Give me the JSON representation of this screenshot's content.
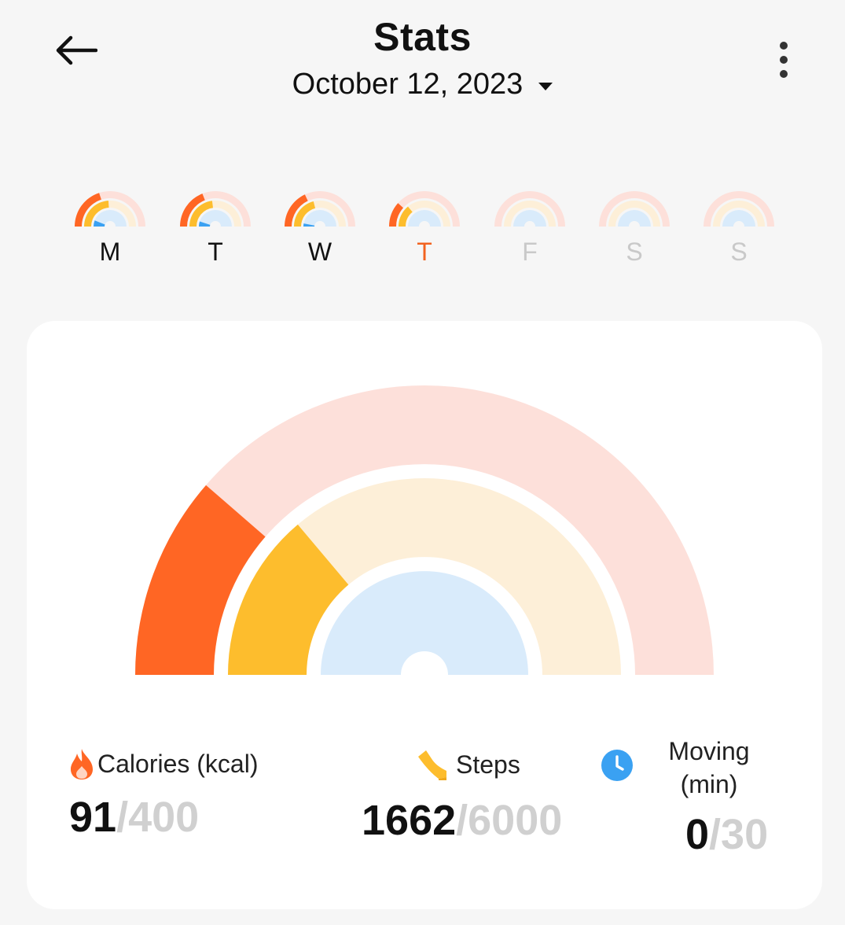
{
  "header": {
    "title": "Stats",
    "date": "October 12, 2023"
  },
  "week": {
    "days": [
      {
        "label": "M",
        "calories_progress": 0.4,
        "steps_progress": 0.48,
        "moving_progress": 0.12,
        "state": "past"
      },
      {
        "label": "T",
        "calories_progress": 0.38,
        "steps_progress": 0.46,
        "moving_progress": 0.1,
        "state": "past"
      },
      {
        "label": "W",
        "calories_progress": 0.36,
        "steps_progress": 0.42,
        "moving_progress": 0.06,
        "state": "past"
      },
      {
        "label": "T",
        "calories_progress": 0.23,
        "steps_progress": 0.28,
        "moving_progress": 0.0,
        "state": "today"
      },
      {
        "label": "F",
        "calories_progress": 0.0,
        "steps_progress": 0.0,
        "moving_progress": 0.0,
        "state": "future"
      },
      {
        "label": "S",
        "calories_progress": 0.0,
        "steps_progress": 0.0,
        "moving_progress": 0.0,
        "state": "future"
      },
      {
        "label": "S",
        "calories_progress": 0.0,
        "steps_progress": 0.0,
        "moving_progress": 0.0,
        "state": "future"
      }
    ]
  },
  "stats": {
    "calories": {
      "label": "Calories (kcal)",
      "value": "91",
      "goal": "/400",
      "icon": "flame-icon"
    },
    "steps": {
      "label": "Steps",
      "value": "1662",
      "goal": "/6000",
      "icon": "shoe-icon"
    },
    "moving": {
      "label_line1": "Moving",
      "label_line2": "(min)",
      "value": "0",
      "goal": "/30",
      "icon": "clock-icon"
    }
  },
  "colors": {
    "calories": "#ff6624",
    "calories_track": "#fde0da",
    "steps": "#fdbd2d",
    "steps_track": "#fdefd8",
    "moving": "#3aa1f2",
    "moving_track": "#d9ebfb",
    "today_label": "#f2621f",
    "future_label": "#c9c9c9",
    "past_label": "#111111"
  }
}
